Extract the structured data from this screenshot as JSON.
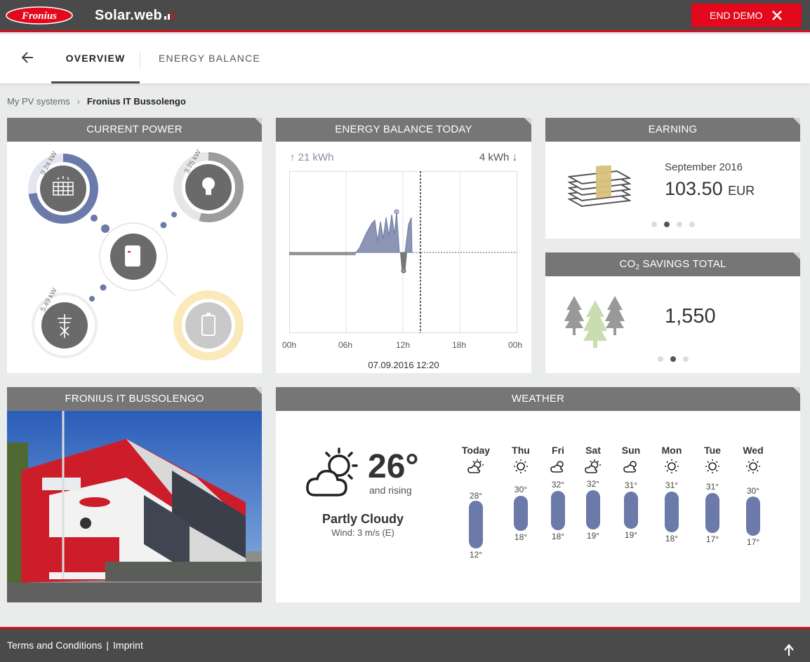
{
  "header": {
    "logo_text": "Fronius",
    "brand": "Solar.web",
    "end_demo_label": "END DEMO"
  },
  "nav": {
    "tabs": [
      {
        "label": "OVERVIEW",
        "active": true
      },
      {
        "label": "ENERGY BALANCE",
        "active": false
      }
    ]
  },
  "breadcrumb": {
    "parent": "My PV systems",
    "current": "Fronius IT Bussolengo"
  },
  "current_power": {
    "title": "CURRENT POWER",
    "pv_label": "9.24 kW",
    "load_label": "3.75 kW",
    "grid_label": "5.49 kW",
    "icons": [
      "solar-panel-icon",
      "light-bulb-icon",
      "inverter-icon",
      "power-pylon-icon",
      "battery-icon"
    ]
  },
  "energy_balance": {
    "title": "ENERGY BALANCE TODAY",
    "produced": "21 kWh",
    "consumed": "4 kWh",
    "ticks": [
      "00h",
      "06h",
      "12h",
      "18h",
      "00h"
    ],
    "timestamp": "07.09.2016 12:20"
  },
  "earning": {
    "title": "EARNING",
    "month": "September 2016",
    "value": "103.50",
    "currency": "EUR"
  },
  "co2": {
    "title_prefix": "CO",
    "title_sub": "2",
    "title_suffix": " SAVINGS TOTAL",
    "value": "1,550"
  },
  "site": {
    "title": "FRONIUS IT BUSSOLENGO"
  },
  "weather": {
    "title": "WEATHER",
    "current_temp": "26°",
    "trend": "and rising",
    "condition": "Partly Cloudy",
    "wind": "Wind: 3 m/s (E)",
    "days": [
      {
        "name": "Today",
        "icon": "partly-cloudy-icon",
        "high": "28°",
        "low": "12°"
      },
      {
        "name": "Thu",
        "icon": "sun-icon",
        "high": "30°",
        "low": "18°"
      },
      {
        "name": "Fri",
        "icon": "cloud-sun-icon",
        "high": "32°",
        "low": "18°"
      },
      {
        "name": "Sat",
        "icon": "partly-cloudy-icon",
        "high": "32°",
        "low": "19°"
      },
      {
        "name": "Sun",
        "icon": "cloud-sun-icon",
        "high": "31°",
        "low": "19°"
      },
      {
        "name": "Mon",
        "icon": "sun-icon",
        "high": "31°",
        "low": "18°"
      },
      {
        "name": "Tue",
        "icon": "sun-icon",
        "high": "31°",
        "low": "17°"
      },
      {
        "name": "Wed",
        "icon": "sun-icon",
        "high": "30°",
        "low": "17°"
      }
    ]
  },
  "footer": {
    "terms": "Terms and Conditions",
    "separator": "|",
    "imprint": "Imprint"
  },
  "colors": {
    "accent": "#e3081b",
    "bar": "#4a4a4b",
    "card_header": "#767676",
    "series": "#6b7aa8"
  }
}
